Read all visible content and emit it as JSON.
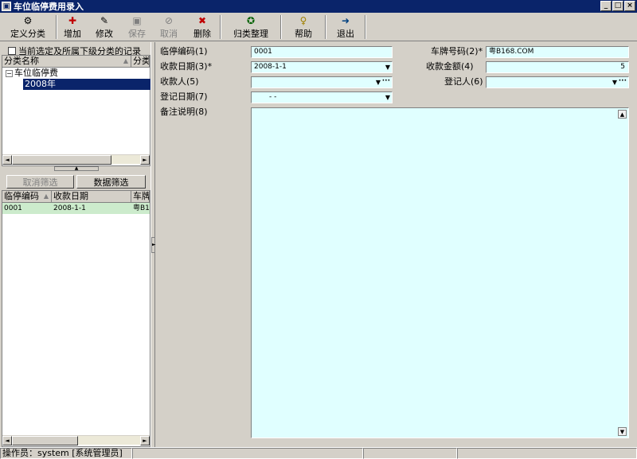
{
  "window": {
    "title": "车位临停费用录入",
    "controls": [
      "_",
      "□",
      "×"
    ]
  },
  "toolbar": {
    "items": [
      {
        "label": "定义分类",
        "icon": "category-icon",
        "glyph": "⚙",
        "enabled": true
      },
      {
        "label": "增加",
        "icon": "add-icon",
        "glyph": "✚",
        "enabled": true
      },
      {
        "label": "修改",
        "icon": "edit-icon",
        "glyph": "✎",
        "enabled": true
      },
      {
        "label": "保存",
        "icon": "save-icon",
        "glyph": "▣",
        "enabled": false
      },
      {
        "label": "取消",
        "icon": "cancel-icon",
        "glyph": "⊘",
        "enabled": false
      },
      {
        "label": "删除",
        "icon": "delete-icon",
        "glyph": "✖",
        "enabled": true
      },
      {
        "label": "归类整理",
        "icon": "organize-icon",
        "glyph": "✪",
        "enabled": true
      },
      {
        "label": "帮助",
        "icon": "help-icon",
        "glyph": "♀",
        "enabled": true
      },
      {
        "label": "退出",
        "icon": "exit-icon",
        "glyph": "➜",
        "enabled": true
      }
    ]
  },
  "left": {
    "checkbox_label": "当前选定及所属下级分类的记录",
    "tree": {
      "columns": [
        "分类名称",
        "分类"
      ],
      "root": "车位临停费",
      "root_toggle": "−",
      "selected_child": "2008年"
    },
    "buttons": {
      "cancel_filter": "取消筛选",
      "data_filter": "数据筛选"
    },
    "list": {
      "columns": [
        "临停编码",
        "收款日期",
        "车牌"
      ],
      "rows": [
        {
          "code": "0001",
          "date": "2008-1-1",
          "plate": "粤B1"
        }
      ]
    }
  },
  "form": {
    "code_label": "临停编码(1)",
    "code_value": "0001",
    "plate_label": "车牌号码(2)*",
    "plate_value": "粤B168.COM",
    "date_label": "收款日期(3)*",
    "date_value": "2008-1-1",
    "amount_label": "收款金额(4)",
    "amount_value": "5",
    "payee_label": "收款人(5)",
    "payee_value": "",
    "registrar_label": "登记人(6)",
    "registrar_value": "",
    "reg_date_label": "登记日期(7)",
    "reg_date_value": "-  -",
    "notes_label": "备注说明(8)",
    "notes_value": ""
  },
  "status": {
    "operator": "操作员：system [系统管理员]",
    "cell2": "",
    "cell3": "",
    "cell4": ""
  }
}
